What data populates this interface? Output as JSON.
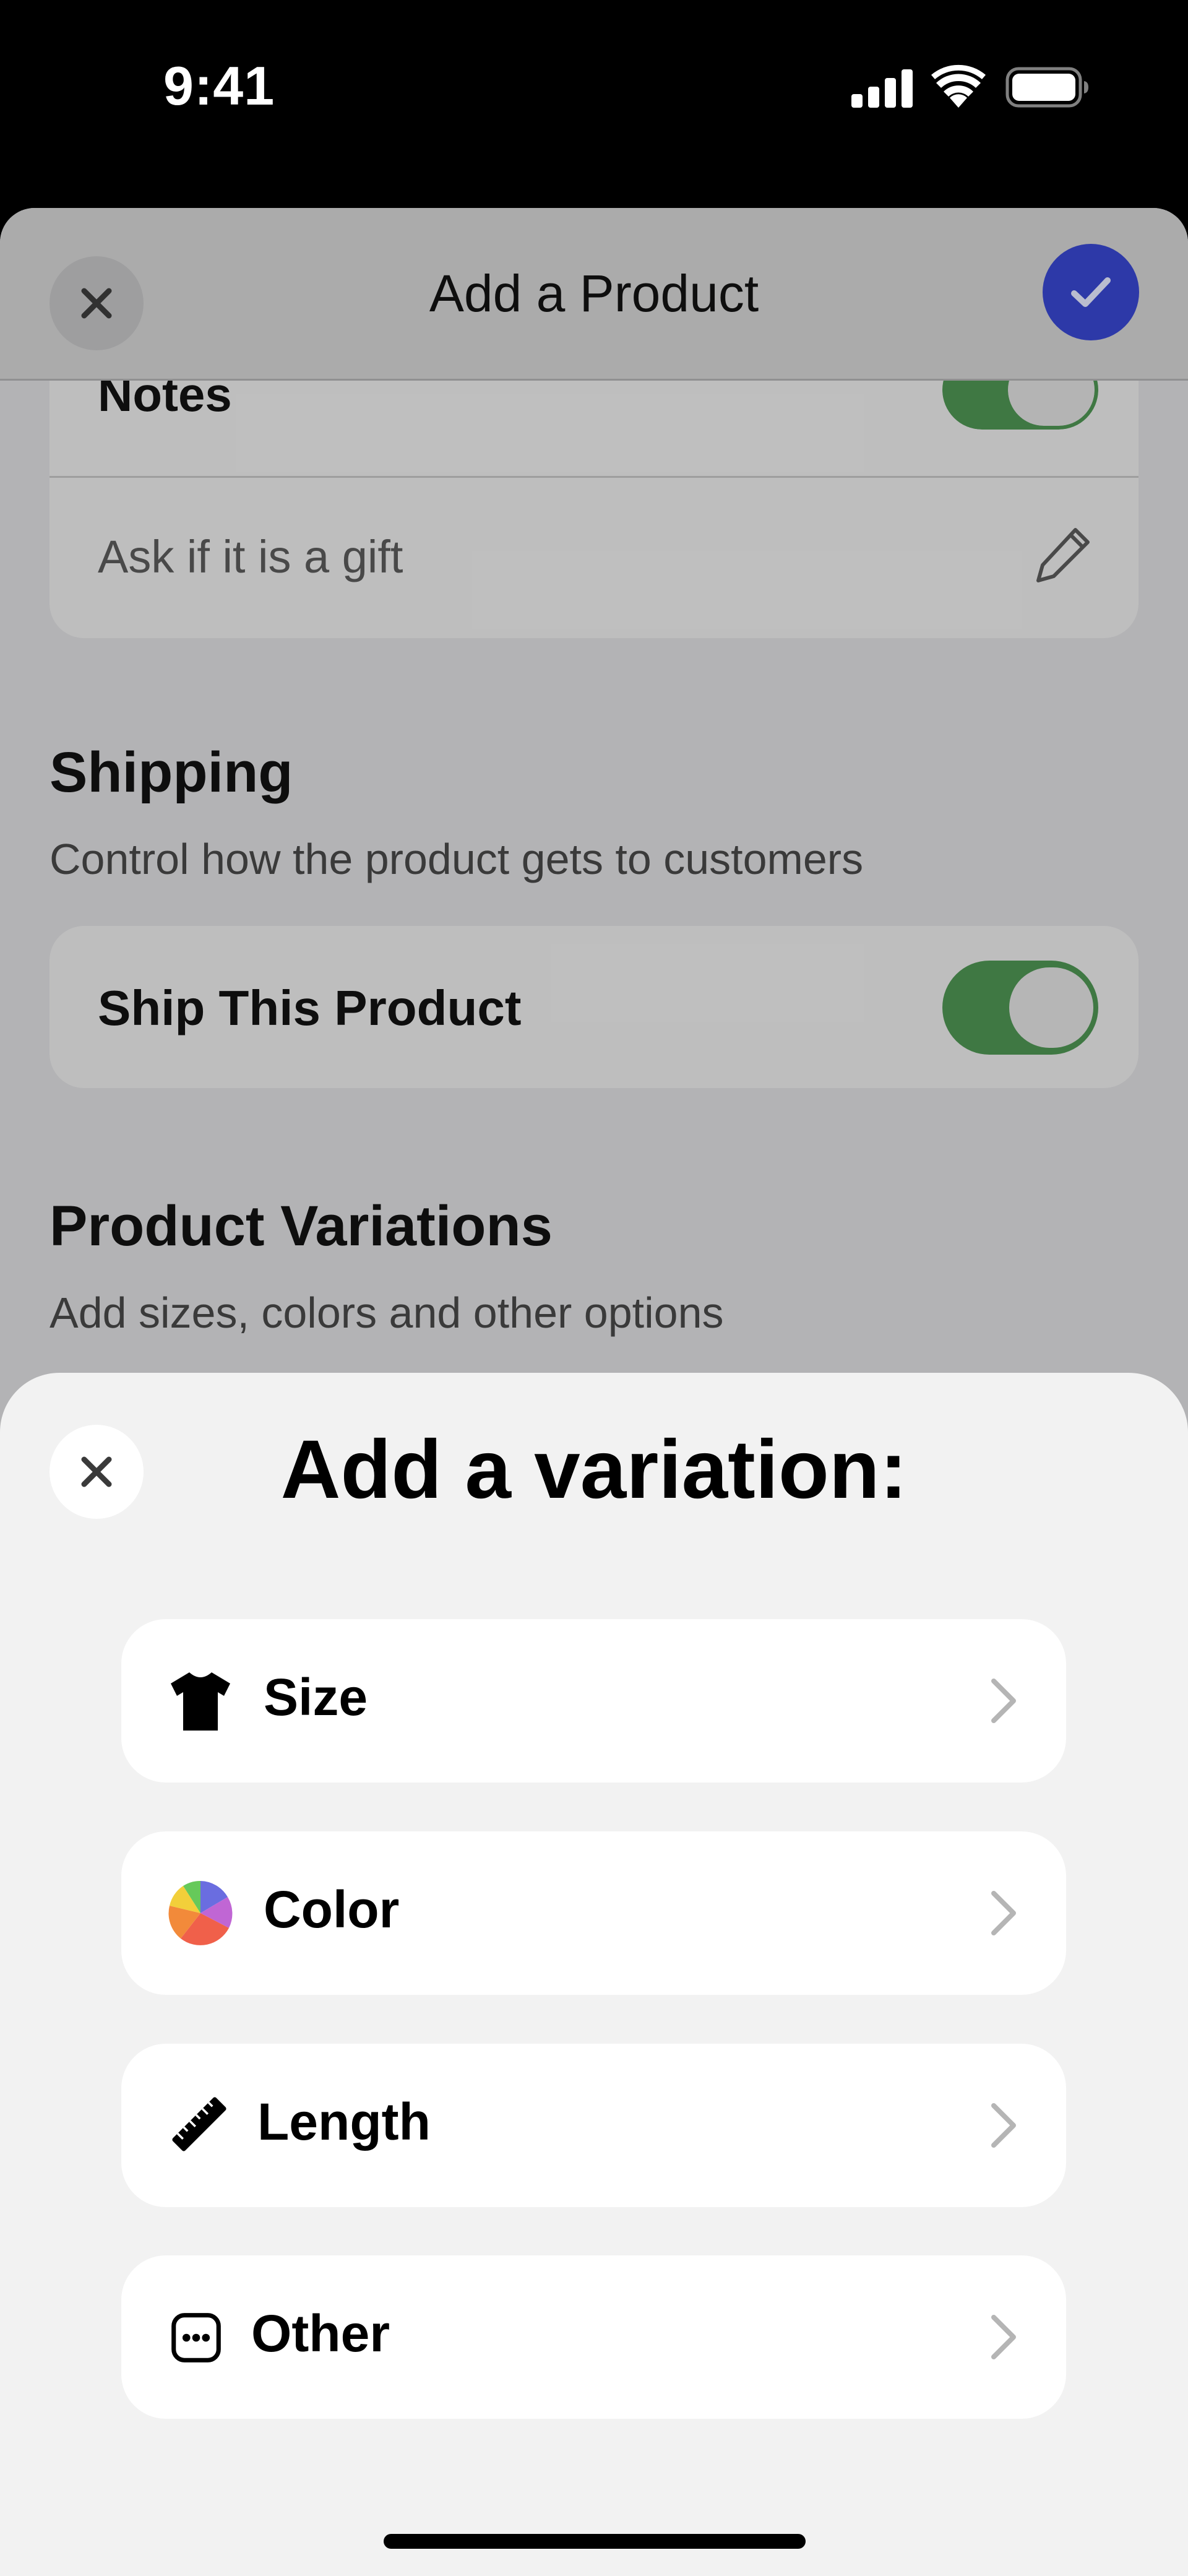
{
  "status_bar": {
    "time": "9:41",
    "icons": [
      "cellular-signal-icon",
      "wifi-icon",
      "battery-icon"
    ]
  },
  "product_sheet": {
    "title": "Add a Product",
    "close_icon": "close-icon",
    "confirm_icon": "checkmark-icon",
    "accent_color": "#3543c4",
    "notes": {
      "label": "Notes",
      "toggle_on": true,
      "placeholder": "Ask if it is a gift",
      "edit_icon": "pencil-icon"
    },
    "shipping": {
      "title": "Shipping",
      "subtitle": "Control how the product gets to customers",
      "toggle_label": "Ship This Product",
      "toggle_on": true,
      "toggle_color": "#4a8c4f"
    },
    "variations": {
      "title": "Product Variations",
      "subtitle": "Add sizes, colors and other options"
    }
  },
  "variation_sheet": {
    "title": "Add a variation:",
    "close_icon": "close-icon",
    "options": [
      {
        "label": "Size",
        "icon": "tshirt-icon"
      },
      {
        "label": "Color",
        "icon": "color-wheel-icon"
      },
      {
        "label": "Length",
        "icon": "ruler-icon"
      },
      {
        "label": "Other",
        "icon": "ellipsis-square-icon"
      }
    ],
    "chevron_icon": "chevron-right-icon"
  }
}
